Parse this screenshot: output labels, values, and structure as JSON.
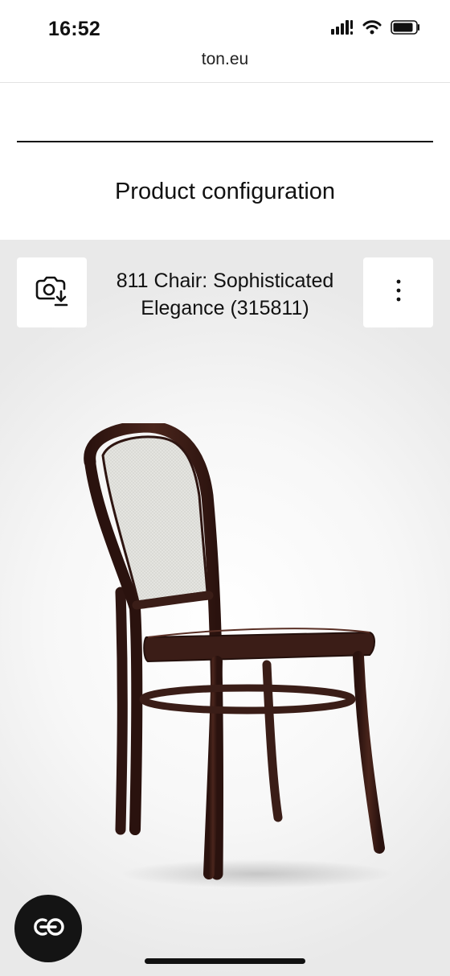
{
  "status_bar": {
    "time": "16:52",
    "icons": [
      "cellular-signal-icon",
      "wifi-icon",
      "battery-icon"
    ]
  },
  "browser": {
    "url": "ton.eu"
  },
  "page": {
    "title": "Product configuration"
  },
  "configurator": {
    "product_name": "811 Chair: Sophisticated Elegance (315811)",
    "buttons": {
      "screenshot": "camera-download-icon",
      "more": "more-vertical-icon",
      "fab": "co-logo-icon"
    },
    "colors": {
      "wood": "#3b1d17",
      "mesh": "#e3e3df",
      "fab": "#141414"
    }
  }
}
